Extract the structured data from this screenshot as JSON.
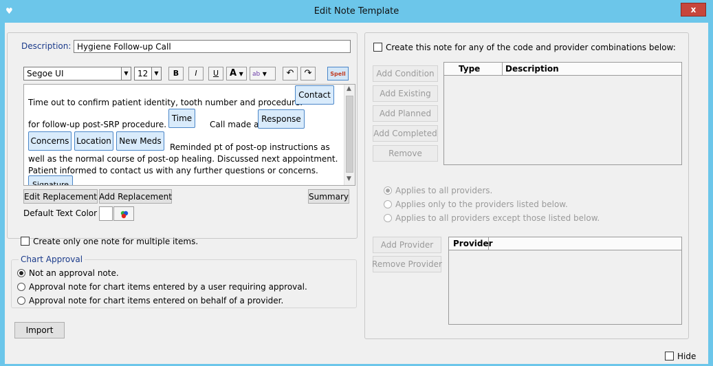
{
  "window": {
    "title": "Edit Note Template",
    "close_label": "x"
  },
  "editor": {
    "description_label": "Description:",
    "description_value": "Hygiene Follow-up Call",
    "font_name": "Segoe UI",
    "font_size": "12",
    "toolbar": {
      "bold": "B",
      "italic": "I",
      "underline": "U",
      "font_color": "A",
      "highlight": "ab",
      "spell": "Spell"
    },
    "text_lines": [
      "Time out to confirm patient identity, tooth number and procedure.",
      "for follow-up post-SRP procedure.",
      "Call made and",
      "Reminded pt of post-op instructions as",
      "well as the normal course of post-op healing.  Discussed next appointment.",
      "Patient informed to contact us with any further questions or concerns."
    ],
    "tokens": [
      "Contact",
      "Time",
      "Response",
      "Concerns",
      "Location",
      "New Meds",
      "Signature"
    ],
    "edit_replacement": "Edit Replacement",
    "add_replacement": "Add Replacement",
    "summary": "Summary",
    "default_text_color": "Default Text Color"
  },
  "one_note_checkbox": "Create only one note for multiple items.",
  "chart_approval": {
    "legend": "Chart Approval",
    "options": [
      "Not an approval note.",
      "Approval note for chart items entered by a user requiring approval.",
      "Approval note for chart items entered on behalf of a provider."
    ]
  },
  "import_button": "Import",
  "conditions": {
    "create_for_checkbox": "Create this note for any of the code and provider combinations below:",
    "buttons": [
      "Add Condition",
      "Add Existing",
      "Add Planned",
      "Add Completed",
      "Remove"
    ],
    "columns": [
      "Type",
      "Description"
    ],
    "provider_options": [
      "Applies to all providers.",
      "Applies only to the providers listed below.",
      "Applies to all providers except those listed below."
    ],
    "add_provider": "Add Provider",
    "remove_provider": "Remove Provider",
    "provider_column": "Provider"
  },
  "hide_checkbox": "Hide",
  "colors": {
    "titlebar": "#6cc6ea",
    "close": "#c7463c",
    "token_border": "#4a86c8",
    "token_fill": "#d9ebfb"
  }
}
